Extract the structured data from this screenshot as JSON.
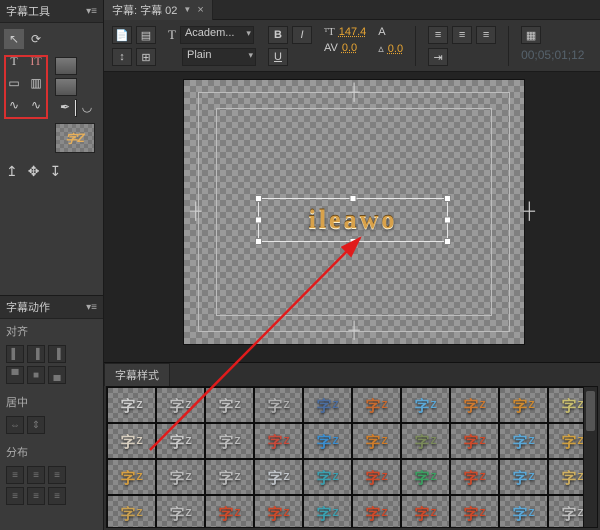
{
  "tools_panel": {
    "title": "字幕工具",
    "tools": [
      "selection",
      "rotation",
      "type-T",
      "vertical-type-IT",
      "area-type",
      "vertical-area",
      "path-type",
      "path-type-vert",
      "pen",
      "add-anchor",
      "rect",
      "ellipse",
      "wedge",
      "arc",
      "line",
      "rounded-rect"
    ],
    "anchors": [
      "top",
      "center",
      "bottom"
    ]
  },
  "actions_panel": {
    "title": "字幕动作",
    "sections": {
      "align": "对齐",
      "center": "居中",
      "distribute": "分布"
    }
  },
  "tab": {
    "label": "字幕: 字幕 02"
  },
  "properties": {
    "font_family": "Academ...",
    "font_style": "Plain",
    "font_size": "147.4",
    "kerning": "0.0",
    "leading": "0.0",
    "timecode": "00;05;01;12"
  },
  "canvas": {
    "text": "ileawo"
  },
  "styles_panel": {
    "title": "字幕样式",
    "glyph_main": "字",
    "glyph_sub": "Z",
    "colors": [
      [
        "#cfcfcf",
        "#bfbfbf",
        "#bfbfbf",
        "#b0b0b0",
        "#4b6da0",
        "#c96a2e",
        "#5aa8d8",
        "#d17a2e",
        "#d08a2e",
        "#c9be6e"
      ],
      [
        "#d8cfc0",
        "#c9c9c9",
        "#bcbcbc",
        "#c94a3a",
        "#3a8ed0",
        "#cf7d2a",
        "#7a8a5a",
        "#cf4a2a",
        "#5aa8d8",
        "#d0a040"
      ],
      [
        "#d8a040",
        "#bcbcbc",
        "#bcbcbc",
        "#c0c4c9",
        "#3aa0b0",
        "#cf4a2a",
        "#3aa060",
        "#cf4a2a",
        "#5aa8d8",
        "#d0b060"
      ],
      [
        "#c9a050",
        "#bcbcbc",
        "#cf4a2a",
        "#cf4a2a",
        "#3aa0b0",
        "#cf4a2a",
        "#cf4a2a",
        "#cf4a2a",
        "#5aa8d8",
        "#bfbfbf"
      ]
    ]
  }
}
